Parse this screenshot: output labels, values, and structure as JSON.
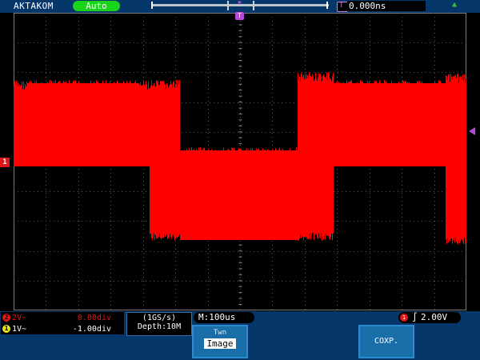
{
  "topbar": {
    "brand": "AKTAKOM",
    "mode": "Auto",
    "trigger_pos_label": "T",
    "trigger_pos_value": "0.000ns",
    "status_icon": "run-status-icon"
  },
  "screen": {
    "trigger_marker": "T",
    "ch1_marker": "1",
    "grid": {
      "h_divs": 14,
      "v_divs": 10
    },
    "colors": {
      "waveform": "#ff0000",
      "grid": "#5a5a5a",
      "trigger": "#b44ad6",
      "background": "#000000"
    }
  },
  "channels": [
    {
      "num": "2",
      "coupling": "2V~",
      "offset": "0.00div",
      "color": "#e21616"
    },
    {
      "num": "1",
      "coupling": "1V~",
      "offset": "-1.00div",
      "color": "#e8e816"
    }
  ],
  "acquisition": {
    "rate": "(1GS/s)",
    "depth": "Depth:10M"
  },
  "timebase": "M:100us",
  "trigger": {
    "source": "1",
    "edge": "∫",
    "level": "2.00V"
  },
  "menu": {
    "image_button": {
      "caption": "Twn",
      "value": "Image"
    },
    "comp_button": "COXP."
  }
}
